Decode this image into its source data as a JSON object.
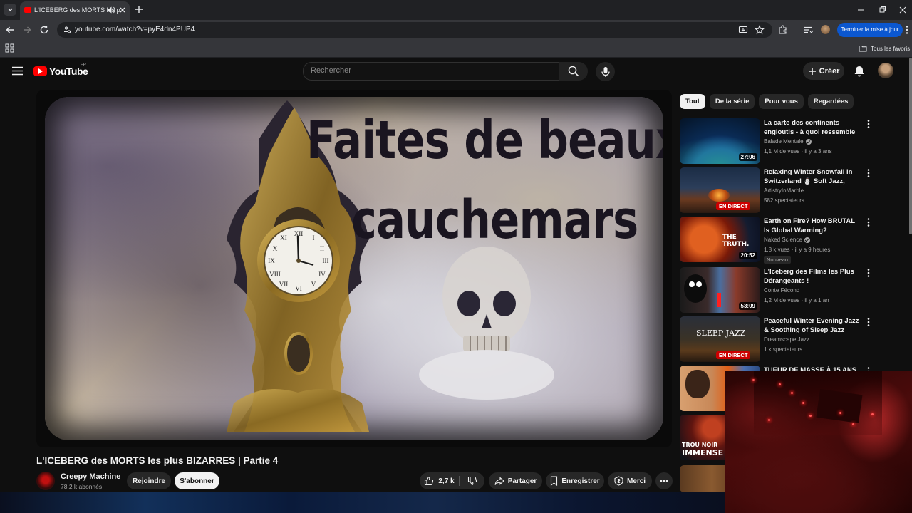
{
  "browser": {
    "tab_title": "L'ICEBERG des MORTS les p",
    "url": "youtube.com/watch?v=pyE4dn4PUP4",
    "update_button": "Terminer la mise à jour",
    "bookmarks_folder": "Tous les favoris"
  },
  "header": {
    "logo_text": "YouTube",
    "region": "FR",
    "search_placeholder": "Rechercher",
    "create_label": "Créer"
  },
  "video": {
    "overlay_line1": "Faites de beaux",
    "overlay_line2": "cauchemars",
    "title": "L'ICEBERG des MORTS les plus BIZARRES | Partie 4",
    "channel_name": "Creepy Machine",
    "subscribers": "78,2 k abonnés",
    "join_label": "Rejoindre",
    "subscribe_label": "S'abonner",
    "like_count": "2,7 k",
    "share_label": "Partager",
    "save_label": "Enregistrer",
    "thanks_label": "Merci"
  },
  "sidebar": {
    "chips": [
      {
        "label": "Tout",
        "active": true
      },
      {
        "label": "De la série",
        "active": false
      },
      {
        "label": "Pour vous",
        "active": false
      },
      {
        "label": "Regardées",
        "active": false
      }
    ],
    "recommendations": [
      {
        "title": "La carte des continents engloutis - à quoi ressemble la...",
        "channel": "Balade Mentale",
        "verified": true,
        "meta": "1,1 M de vues · il y a 3 ans",
        "duration": "27:06"
      },
      {
        "title": "Relaxing Winter Snowfall in Switzerland ⛄ Soft Jazz, Coz...",
        "channel": "ArtistryInMarble",
        "verified": false,
        "meta": "582 spectateurs",
        "live": "EN DIRECT"
      },
      {
        "title": "Earth on Fire? How BRUTAL Is Global Warming?",
        "channel": "Naked Science",
        "verified": true,
        "meta": "1,8 k vues · il y a 9 heures",
        "badge": "Nouveau",
        "duration": "20:52",
        "thumb_text": "THE TRUTH."
      },
      {
        "title": "L'Iceberg des Films les Plus Dérangeants !",
        "channel": "Conte Fécond",
        "verified": false,
        "meta": "1,2 M de vues · il y a 1 an",
        "duration": "53:09"
      },
      {
        "title": "Peaceful Winter Evening Jazz & Soothing of Sleep Jazz Piano ...",
        "channel": "Dreamscape Jazz",
        "verified": false,
        "meta": "1 k spectateurs",
        "live": "EN DIRECT",
        "thumb_text": "SLEEP JAZZ"
      },
      {
        "title": "TUEUR DE MASSE À 15 ANS,"
      },
      {
        "thumb_text_1": "TROU NOIR",
        "thumb_text_2": "IMMENSE"
      }
    ]
  }
}
